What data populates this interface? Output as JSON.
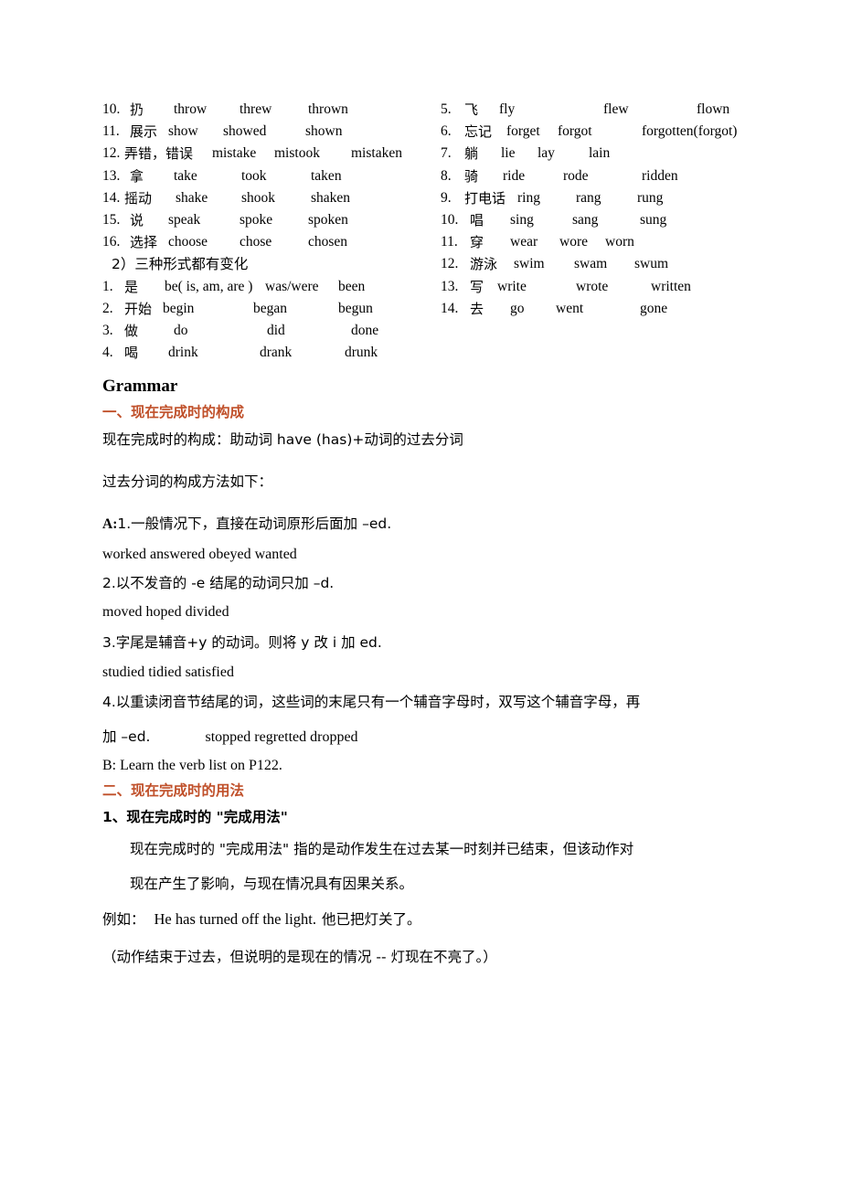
{
  "verb_table": {
    "left_column": {
      "rows": [
        {
          "num": "10.",
          "cn": "扔",
          "v1": "throw",
          "v2": "threw",
          "v3": "thrown"
        },
        {
          "num": "11.",
          "cn": "展示",
          "v1": "show",
          "v2": "showed",
          "v3": "shown"
        },
        {
          "num": "12.",
          "cn": "弄错，错误",
          "v1": "mistake",
          "v2": "mistook",
          "v3": "mistaken"
        },
        {
          "num": "13.",
          "cn": "拿",
          "v1": "take",
          "v2": "took",
          "v3": "taken"
        },
        {
          "num": "14.",
          "cn": "摇动",
          "v1": "shake",
          "v2": "shook",
          "v3": "shaken"
        },
        {
          "num": "15.",
          "cn": "说",
          "v1": "speak",
          "v2": "spoke",
          "v3": "spoken"
        },
        {
          "num": "16.",
          "cn": "选择",
          "v1": "choose",
          "v2": "chose",
          "v3": "chosen"
        }
      ],
      "subheading": "2）三种形式都有变化",
      "rows2": [
        {
          "num": "1.",
          "cn": "是",
          "v1": "be( is, am, are )",
          "v2": "was/were",
          "v3": "been"
        },
        {
          "num": "2.",
          "cn": "开始",
          "v1": "begin",
          "v2": "began",
          "v3": "begun"
        },
        {
          "num": "3.",
          "cn": "做",
          "v1": "do",
          "v2": "did",
          "v3": "done"
        },
        {
          "num": "4.",
          "cn": "喝",
          "v1": "drink",
          "v2": "drank",
          "v3": "drunk"
        }
      ]
    },
    "right_column": {
      "rows": [
        {
          "num": "5.",
          "cn": "飞",
          "v1": "fly",
          "v2": "flew",
          "v3": "flown"
        },
        {
          "num": "6.",
          "cn": "忘记",
          "v1": "forget",
          "v2": "forgot",
          "v3": "forgotten(forgot)"
        },
        {
          "num": "7.",
          "cn": "躺",
          "v1": "lie",
          "v2": "lay",
          "v3": "lain"
        },
        {
          "num": "8.",
          "cn": "骑",
          "v1": "ride",
          "v2": "rode",
          "v3": "ridden"
        },
        {
          "num": "9.",
          "cn": "打电话",
          "v1": "ring",
          "v2": "rang",
          "v3": "rung"
        },
        {
          "num": "10.",
          "cn": "唱",
          "v1": "sing",
          "v2": "sang",
          "v3": "sung"
        },
        {
          "num": "11.",
          "cn": "穿",
          "v1": "wear",
          "v2": "wore",
          "v3": "worn"
        },
        {
          "num": "12.",
          "cn": "游泳",
          "v1": "swim",
          "v2": "swam",
          "v3": "swum"
        },
        {
          "num": "13.",
          "cn": "写",
          "v1": "write",
          "v2": "wrote",
          "v3": "written"
        },
        {
          "num": "14.",
          "cn": "去",
          "v1": "go",
          "v2": "went",
          "v3": "gone"
        }
      ]
    }
  },
  "grammar": {
    "title": "Grammar",
    "section1_heading": "一、现在完成时的构成",
    "section1_line1": "现在完成时的构成：助动词 have (has)+动词的过去分词",
    "section1_line2": "过去分词的构成方法如下：",
    "rule_a_label": "A:",
    "rule_a1": "1.一般情况下，直接在动词原形后面加 –ed.",
    "rule_a1_examples": "worked   answered   obeyed   wanted",
    "rule_a2": "2.以不发音的 -e 结尾的动词只加 –d.",
    "rule_a2_examples": "moved   hoped  divided",
    "rule_a3": "3.字尾是辅音+y 的动词。则将 y 改 i 加 ed.",
    "rule_a3_examples": "studied   tidied   satisfied",
    "rule_a4": "4.以重读闭音节结尾的词，这些词的末尾只有一个辅音字母时，双写这个辅音字母，再",
    "rule_a4_cont": "加 –ed.",
    "rule_a4_examples": "stopped   regretted dropped",
    "rule_b": "B: Learn the verb list on P122.",
    "section2_heading": "二、现在完成时的用法",
    "usage1_heading": "1、现在完成时的 \"完成用法\"",
    "usage1_body_line1": "现在完成时的 \"完成用法\" 指的是动作发生在过去某一时刻并已结束，但该动作对",
    "usage1_body_line2": "现在产生了影响，与现在情况具有因果关系。",
    "example_label": "例如：",
    "example_en": "He has turned off the light.",
    "example_cn": "他已把灯关了。",
    "note": "（动作结束于过去，但说明的是现在的情况 -- 灯现在不亮了。）"
  },
  "colors": {
    "heading_orange": "#C0502A",
    "body_black": "#000000",
    "page_background": "#FFFFFF"
  }
}
